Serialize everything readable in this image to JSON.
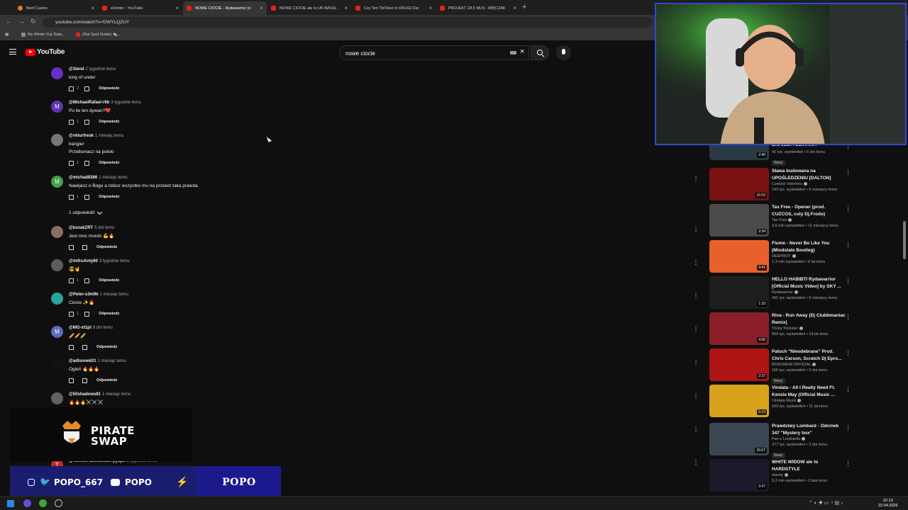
{
  "browser": {
    "tabs": [
      {
        "label": "Beef Casino",
        "active": false
      },
      {
        "label": "eXmiter - YouTube",
        "active": false
      },
      {
        "label": "NOWE CIOCIE - Rydawarrior (o",
        "active": true
      },
      {
        "label": "NOWE CIOCIE ale to UK BASSL",
        "active": false
      },
      {
        "label": "Czy Ten TikToker to DRUGI Dar",
        "active": false
      },
      {
        "label": "PROJEKT ZA 5 MLN - MIĘCZAK",
        "active": false
      }
    ],
    "url": "youtube.com/watch?v=f2WYLQZUY",
    "bookmarks": [
      "My Winter Car Data...",
      "(Rat Spot Guide) 🐀..."
    ]
  },
  "youtube": {
    "logo_text": "YouTube",
    "search_value": "nowe ciocie"
  },
  "comments": [
    {
      "author": "@3iend",
      "time": "2 tygodnie temu",
      "text": [
        "king of under"
      ],
      "likes": "2",
      "reply": "Odpowiedz",
      "avatar_letter": "",
      "avatar_color": "#6a2fc4"
    },
    {
      "author": "@MichaelRafael-r6b",
      "time": "3 tygodnie temu",
      "text": [
        "Po ile ten dywan?❤️"
      ],
      "likes": "1",
      "reply": "Odpowiedz",
      "avatar_letter": "M",
      "avatar_color": "#5e35b1"
    },
    {
      "author": "@vkturfresk",
      "time": "1 miesiąc temu",
      "text": [
        "bangier",
        "Przetłumacz na polski"
      ],
      "likes": "1",
      "reply": "Odpowiedz",
      "avatar_letter": "",
      "avatar_color": "#777777"
    },
    {
      "author": "@michad9286",
      "time": "1 miesiąc temu",
      "text": [
        "Nawijasz o Bogu a robisz wszystko mu na przekór taka prawda"
      ],
      "likes": "1",
      "reply": "Odpowiedz",
      "avatar_letter": "M",
      "avatar_color": "#43a047"
    },
    {
      "author": "@kozakZRT",
      "time": "5 dni temu",
      "text": [
        "Jest moc mordo 💪🔥"
      ],
      "likes": "",
      "reply": "Odpowiedz",
      "avatar_letter": "",
      "avatar_color": "#8d6e63"
    },
    {
      "author": "@mifruAnty60",
      "time": "3 tygodnie temu",
      "text": [
        "😎🤘"
      ],
      "likes": "1",
      "reply": "Odpowiedz",
      "avatar_letter": "",
      "avatar_color": "#5c5c5c"
    },
    {
      "author": "@Peter-s3m9k",
      "time": "1 miesiąc temu",
      "text": [
        "Ciocie ✨🔥"
      ],
      "likes": "1",
      "reply": "Odpowiedz",
      "avatar_letter": "",
      "avatar_color": "#26a69a"
    },
    {
      "author": "@MG-xt1pt",
      "time": "9 dni temu",
      "text": [
        "🥖🥖🥖"
      ],
      "likes": "",
      "reply": "Odpowiedz",
      "avatar_letter": "M",
      "avatar_color": "#5c6bc0"
    },
    {
      "author": "@adisonek01",
      "time": "1 miesiąc temu",
      "text": [
        "Ogień 🔥🔥🔥"
      ],
      "likes": "",
      "reply": "Odpowiedz",
      "avatar_letter": "",
      "avatar_color": "#111111"
    },
    {
      "author": "@50shadows81",
      "time": "1 miesiąc temu",
      "text": [
        "🔥🔥🔥⚔️⚔️⚔️"
      ],
      "likes": "",
      "reply": "",
      "avatar_letter": "",
      "avatar_color": "#616161"
    },
    {
      "author": "@TomekPawlikowski-py3px",
      "time": "2 tygodnie temu",
      "text": [],
      "likes": "",
      "reply": "",
      "avatar_letter": "T",
      "avatar_color": "#c62828"
    }
  ],
  "replies_toggle": "1 odpowiedź",
  "recommendations": [
    {
      "title": "BIG JEDI I DZIARMA",
      "channel": "",
      "meta": "42 tys. wyświetleń • 5 dni temu",
      "badge": "Nowy",
      "duration": "2:40",
      "thumb_color": "#2a3a44"
    },
    {
      "title": "Sława budowana na UPOŚLEDZENIU [DALTON]",
      "channel": "Czeluść Internetu",
      "meta": "143 tys. wyświetleń • 6 miesięcy temu",
      "badge": "",
      "duration": "16:03",
      "thumb_color": "#7a1212"
    },
    {
      "title": "Tax Free - Opener (prod. CUZCOS, cuty Dj.Frodo)",
      "channel": "Tax Free",
      "meta": "3,6 mln wyświetleń • 11 miesięcy temu",
      "badge": "",
      "duration": "2:34",
      "thumb_color": "#4a4a4a"
    },
    {
      "title": "Flume - Never Be Like You (Mindstate Bootleg)",
      "channel": "DEEPROT",
      "meta": "1,3 mln wyświetleń • 8 lat temu",
      "badge": "",
      "duration": "4:41",
      "thumb_color": "#e8602a"
    },
    {
      "title": "HELLO HABIBTI Rydawarrior [Official Music Video] by SKY ...",
      "channel": "Rydawarrior",
      "meta": "491 tys. wyświetleń • 6 miesięcy temu",
      "badge": "",
      "duration": "1:33",
      "thumb_color": "#1e1e1e"
    },
    {
      "title": "Riva - Run Away (Dj Clubbmaniac Remix)",
      "channel": "Tricky Trickster",
      "meta": "959 tys. wyświetleń • 14 lat temu",
      "badge": "",
      "duration": "4:06",
      "thumb_color": "#8a1f2a"
    },
    {
      "title": "Paluch \"Nieodebrane\" Prod. Chris Carson, Scratch Dj Epro...",
      "channel": "BOROREW OFFICIAL",
      "meta": "166 tys. wyświetleń • 5 dni temu",
      "badge": "Nowy",
      "duration": "2:37",
      "thumb_color": "#b01515"
    },
    {
      "title": "Vindata - All I Really Need Ft. Kenzie May (Official Music ...",
      "channel": "Vindata Music",
      "meta": "169 tys. wyświetleń • 11 lat temu",
      "badge": "",
      "duration": "5:13",
      "thumb_color": "#d8a21c"
    },
    {
      "title": "Prawdziwy Lombard - Odcinek 347 \"Mystery box\"",
      "channel": "Pan z Lombardu",
      "meta": "277 tys. wyświetleń • 2 dni temu",
      "badge": "Nowy",
      "duration": "15:07",
      "thumb_color": "#3b4652"
    },
    {
      "title": "WHITE WIDOW ale to HARDSTYLE",
      "channel": "skeety",
      "meta": "5,2 mln wyświetleń • 3 lata temu",
      "badge": "",
      "duration": "2:47",
      "thumb_color": "#1c1a2a"
    }
  ],
  "overlay": {
    "sponsor_lines": [
      "PIRATE",
      "SWAP"
    ],
    "handle_1": "POPO_667",
    "handle_2": "POPO",
    "name": "POPO"
  },
  "taskbar": {
    "time": "22:13",
    "date": "22.04.2026"
  },
  "colors": {
    "youtube_red": "#ff0000",
    "social_bar": "#1a1d6e",
    "webcam_border": "#3147d6"
  }
}
